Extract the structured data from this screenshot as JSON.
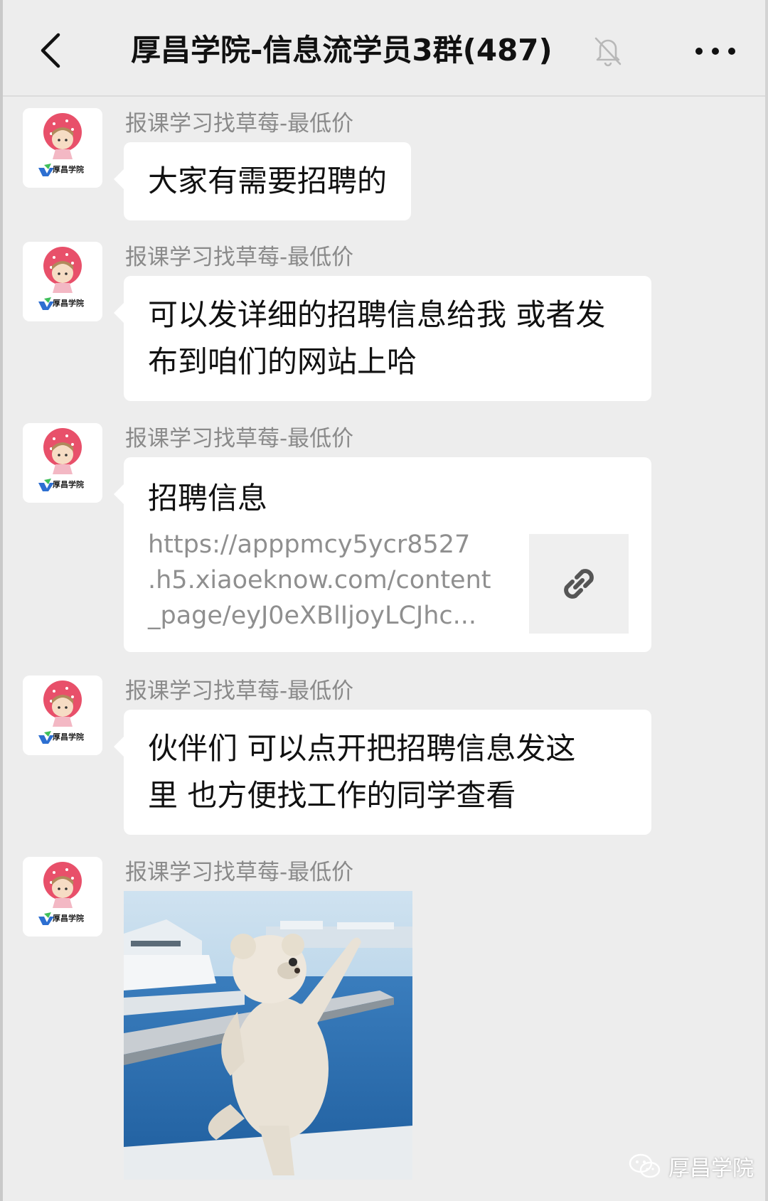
{
  "header": {
    "title": "厚昌学院-信息流学员3群(487)",
    "back_icon": "chevron-left-icon",
    "mute_icon": "bell-off-icon",
    "more_icon": "more-dots-icon"
  },
  "avatar": {
    "caption": "厚昌学院",
    "accent": "#e8506a"
  },
  "messages": [
    {
      "sender": "报课学习找草莓-最低价",
      "type": "text",
      "lines": [
        "大家有需要招聘的"
      ]
    },
    {
      "sender": "报课学习找草莓-最低价",
      "type": "text",
      "lines": [
        "可以发详细的招聘信息给我 或者发",
        "布到咱们的网站上哈"
      ]
    },
    {
      "sender": "报课学习找草莓-最低价",
      "type": "link",
      "title": "招聘信息",
      "url_lines": [
        "https://apppmcy5ycr8527",
        ".h5.xiaoeknow.com/content",
        "_page/eyJ0eXBlIjoyLCJhc..."
      ],
      "thumb_icon": "link-icon"
    },
    {
      "sender": "报课学习找草莓-最低价",
      "type": "text",
      "lines": [
        "伙伴们 可以点开把招聘信息发这",
        "里  也方便找工作的同学查看"
      ]
    },
    {
      "sender": "报课学习找草莓-最低价",
      "type": "sticker",
      "sticker_icon": "dancing-bear-sticker"
    }
  ],
  "watermark": {
    "text": "厚昌学院",
    "icon": "wechat-icon"
  },
  "colors": {
    "background": "#ededed",
    "bubble": "#ffffff",
    "sender_text": "#8a8a8a",
    "url_text": "#8f8f8f"
  }
}
